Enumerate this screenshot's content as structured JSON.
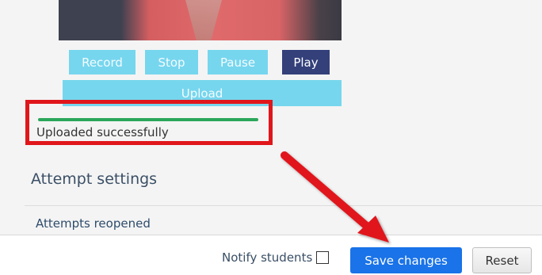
{
  "recorder": {
    "buttons": [
      {
        "label": "Record",
        "active": false
      },
      {
        "label": "Stop",
        "active": false
      },
      {
        "label": "Pause",
        "active": false
      },
      {
        "label": "Play",
        "active": true
      }
    ],
    "upload_label": "Upload",
    "progress_percent": 100,
    "status": "Uploaded successfully"
  },
  "section": {
    "title": "Attempt settings",
    "subheading": "Attempts reopened"
  },
  "footer": {
    "notify_label": "Notify students",
    "notify_checked": false,
    "save_label": "Save changes",
    "reset_label": "Reset"
  },
  "colors": {
    "accent_blue": "#1a73e8",
    "recorder_button": "#76d6ee",
    "active_button": "#33407a",
    "highlight": "#e0161b",
    "progress": "#2aa65a"
  },
  "annotations": [
    "red-highlight-box",
    "red-arrow-icon"
  ]
}
